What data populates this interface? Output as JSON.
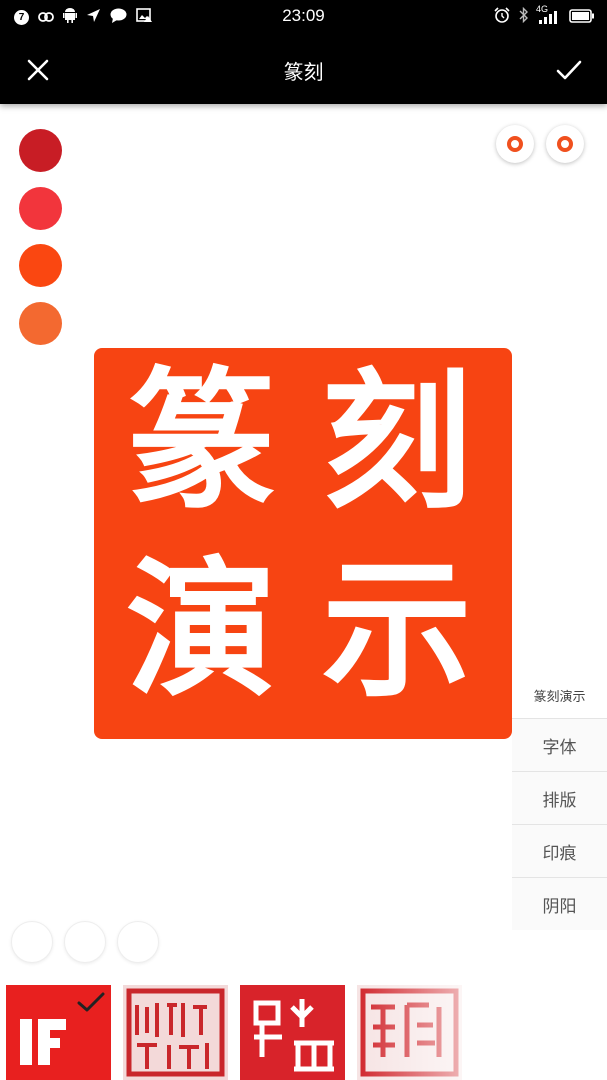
{
  "status_bar": {
    "time": "23:09",
    "badge": "7",
    "network": "4G",
    "icons": [
      "notification-badge-icon",
      "link-icon",
      "android-icon",
      "location-arrow-icon",
      "chat-bubble-icon",
      "image-alert-icon",
      "alarm-clock-icon",
      "bluetooth-icon",
      "signal-icon",
      "battery-icon"
    ]
  },
  "app_bar": {
    "title": "篆刻",
    "close_icon": "close-icon",
    "confirm_icon": "check-icon"
  },
  "colors": {
    "swatches": [
      "#c81d25",
      "#f2353c",
      "#fa4711",
      "#f36930"
    ],
    "seal": "#f74412",
    "accent": "#f0501e"
  },
  "seal": {
    "chars": [
      "篆",
      "刻",
      "演",
      "示"
    ]
  },
  "options": {
    "caption": "篆刻演示",
    "items": [
      "字体",
      "排版",
      "印痕",
      "阴阳"
    ]
  },
  "thumbnails": [
    {
      "name": "style-1",
      "selected": true,
      "text": "IF"
    },
    {
      "name": "style-2",
      "selected": false,
      "text": "乾隆御覽之寶"
    },
    {
      "name": "style-3",
      "selected": false,
      "text": "水山居士"
    },
    {
      "name": "style-4",
      "selected": false,
      "text": "篆刻"
    }
  ]
}
